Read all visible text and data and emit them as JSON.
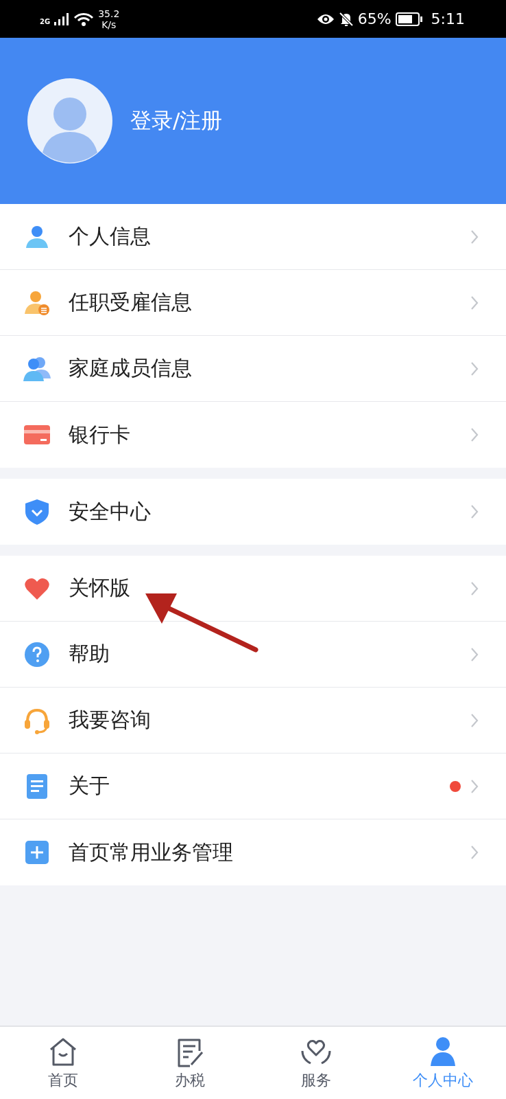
{
  "status_bar": {
    "network": "2G",
    "speed_value": "35.2",
    "speed_unit": "K/s",
    "battery": "65%",
    "time": "5:11"
  },
  "header": {
    "login": "登录/注册"
  },
  "menu_groups": [
    [
      {
        "kind": "person",
        "label": "个人信息",
        "dot": false
      },
      {
        "kind": "employment",
        "label": "任职受雇信息",
        "dot": false
      },
      {
        "kind": "family",
        "label": "家庭成员信息",
        "dot": false
      },
      {
        "kind": "card",
        "label": "银行卡",
        "dot": false
      }
    ],
    [
      {
        "kind": "shield",
        "label": "安全中心",
        "dot": false
      }
    ],
    [
      {
        "kind": "heart",
        "label": "关怀版",
        "dot": false
      },
      {
        "kind": "help",
        "label": "帮助",
        "dot": false
      },
      {
        "kind": "headset",
        "label": "我要咨询",
        "dot": false
      },
      {
        "kind": "doc",
        "label": "关于",
        "dot": true
      },
      {
        "kind": "plus",
        "label": "首页常用业务管理",
        "dot": false
      }
    ]
  ],
  "tab_bar": [
    {
      "kind": "home",
      "label": "首页",
      "selected": false
    },
    {
      "kind": "tax",
      "label": "办税",
      "selected": false
    },
    {
      "kind": "service",
      "label": "服务",
      "selected": false
    },
    {
      "kind": "me",
      "label": "个人中心",
      "selected": true
    }
  ]
}
